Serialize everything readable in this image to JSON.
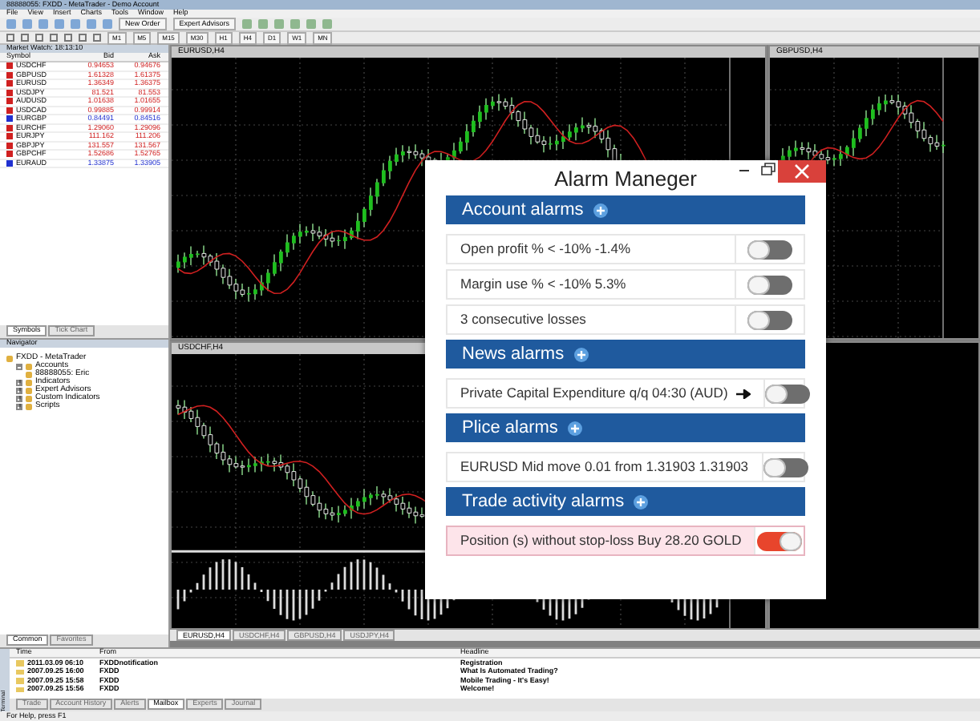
{
  "window": {
    "title": "88888055: FXDD - MetaTrader - Demo Account"
  },
  "menu": [
    "File",
    "View",
    "Insert",
    "Charts",
    "Tools",
    "Window",
    "Help"
  ],
  "toolbar": {
    "buttons": [
      "New Order",
      "Expert Advisors"
    ],
    "timeframes": [
      "M1",
      "M5",
      "M15",
      "M30",
      "H1",
      "H4",
      "D1",
      "W1",
      "MN"
    ]
  },
  "market_watch": {
    "title": "Market Watch: 18:13:10",
    "columns": [
      "Symbol",
      "Bid",
      "Ask"
    ],
    "rows": [
      {
        "symbol": "USDCHF",
        "bid": "0.94653",
        "ask": "0.94676",
        "color": "#d02020"
      },
      {
        "symbol": "GBPUSD",
        "bid": "1.61328",
        "ask": "1.61375",
        "color": "#d02020"
      },
      {
        "symbol": "EURUSD",
        "bid": "1.36349",
        "ask": "1.36375",
        "color": "#d02020"
      },
      {
        "symbol": "USDJPY",
        "bid": "81.521",
        "ask": "81.553",
        "color": "#d02020"
      },
      {
        "symbol": "AUDUSD",
        "bid": "1.01638",
        "ask": "1.01655",
        "color": "#d02020"
      },
      {
        "symbol": "USDCAD",
        "bid": "0.99885",
        "ask": "0.99914",
        "color": "#d02020"
      },
      {
        "symbol": "EURGBP",
        "bid": "0.84491",
        "ask": "0.84516",
        "color": "#2030d0"
      },
      {
        "symbol": "EURCHF",
        "bid": "1.29060",
        "ask": "1.29096",
        "color": "#d02020"
      },
      {
        "symbol": "EURJPY",
        "bid": "111.162",
        "ask": "111.206",
        "color": "#d02020"
      },
      {
        "symbol": "GBPJPY",
        "bid": "131.557",
        "ask": "131.567",
        "color": "#d02020"
      },
      {
        "symbol": "GBPCHF",
        "bid": "1.52686",
        "ask": "1.52765",
        "color": "#d02020"
      },
      {
        "symbol": "EURAUD",
        "bid": "1.33875",
        "ask": "1.33905",
        "color": "#2030d0"
      }
    ],
    "tabs": [
      {
        "label": "Symbols",
        "selected": true
      },
      {
        "label": "Tick Chart",
        "selected": false
      }
    ]
  },
  "navigator": {
    "title": "Navigator",
    "tree": [
      {
        "label": "FXDD - MetaTrader",
        "children": [
          {
            "label": "Accounts",
            "expanded": true,
            "children": [
              {
                "label": "88888055: Eric"
              }
            ]
          },
          {
            "label": "Indicators",
            "expanded": false
          },
          {
            "label": "Expert Advisors",
            "expanded": false
          },
          {
            "label": "Custom Indicators",
            "expanded": false
          },
          {
            "label": "Scripts",
            "expanded": false
          }
        ]
      }
    ],
    "tabs": [
      {
        "label": "Common",
        "selected": true
      },
      {
        "label": "Favorites",
        "selected": false
      }
    ]
  },
  "charts": [
    {
      "title": "EURUSD,H4"
    },
    {
      "title": "GBPUSD,H4"
    },
    {
      "title": "USDCHF,H4"
    }
  ],
  "chart_tabs": [
    {
      "label": "EURUSD,H4",
      "selected": true
    },
    {
      "label": "USDCHF,H4",
      "selected": false
    },
    {
      "label": "GBPUSD,H4",
      "selected": false
    },
    {
      "label": "USDJPY,H4",
      "selected": false
    }
  ],
  "terminal": {
    "label": "Terminal",
    "columns": [
      "Time",
      "From",
      "Headline"
    ],
    "rows": [
      {
        "time": "2011.03.09 06:10",
        "from": "FXDDnotification",
        "headline": "Registration"
      },
      {
        "time": "2007.09.25 16:00",
        "from": "FXDD",
        "headline": "What Is Automated Trading?"
      },
      {
        "time": "2007.09.25 15:58",
        "from": "FXDD",
        "headline": "Mobile Trading - It's Easy!"
      },
      {
        "time": "2007.09.25 15:56",
        "from": "FXDD",
        "headline": "Welcome!"
      }
    ],
    "tabs": [
      {
        "label": "Trade",
        "selected": false
      },
      {
        "label": "Account History",
        "selected": false
      },
      {
        "label": "Alerts",
        "selected": false
      },
      {
        "label": "Mailbox",
        "selected": true
      },
      {
        "label": "Experts",
        "selected": false
      },
      {
        "label": "Journal",
        "selected": false
      }
    ]
  },
  "status_bar": "For Help, press F1",
  "alarm_manager": {
    "title": "Alarm Maneger",
    "sections": [
      {
        "title": "Account alarms",
        "items": [
          {
            "text": "Open profit % < -10% -1.4%",
            "on": false,
            "arrow": false
          },
          {
            "text": "Margin use % < -10% 5.3%",
            "on": false,
            "arrow": false
          },
          {
            "text": "3 consecutive losses",
            "on": false,
            "arrow": false
          }
        ]
      },
      {
        "title": "News alarms",
        "items": [
          {
            "text": "Private Capital Expenditure q/q 04:30 (AUD)",
            "on": false,
            "arrow": true
          }
        ]
      },
      {
        "title": "Plice alarms",
        "items": [
          {
            "text": "EURUSD Mid move 0.01 from 1.31903 1.31903",
            "on": false,
            "arrow": false
          }
        ]
      },
      {
        "title": "Trade activity alarms",
        "items": [
          {
            "text": "Position (s) without stop-loss Buy 28.20 GOLD",
            "on": true,
            "arrow": false
          }
        ]
      }
    ]
  }
}
